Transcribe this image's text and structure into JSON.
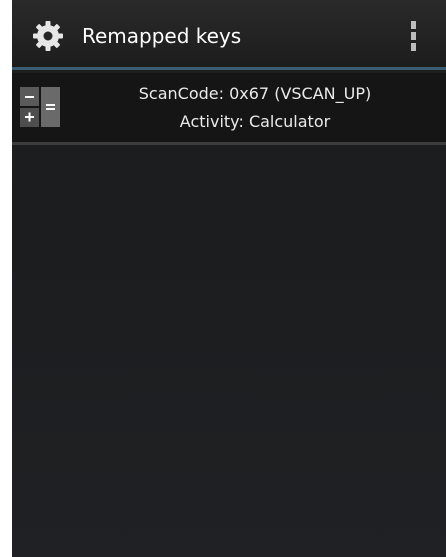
{
  "action_bar": {
    "title": "Remapped keys",
    "icon": "gear-icon",
    "menu_icon": "overflow-menu-icon"
  },
  "remapped_list": {
    "items": [
      {
        "icon": "calculator-icon",
        "scan_code": "ScanCode: 0x67 (VSCAN_UP)",
        "activity": "Activity: Calculator"
      }
    ]
  },
  "colors": {
    "accent_divider": "#3b5d73",
    "background": "#1e1e1e",
    "text": "#ffffff"
  }
}
